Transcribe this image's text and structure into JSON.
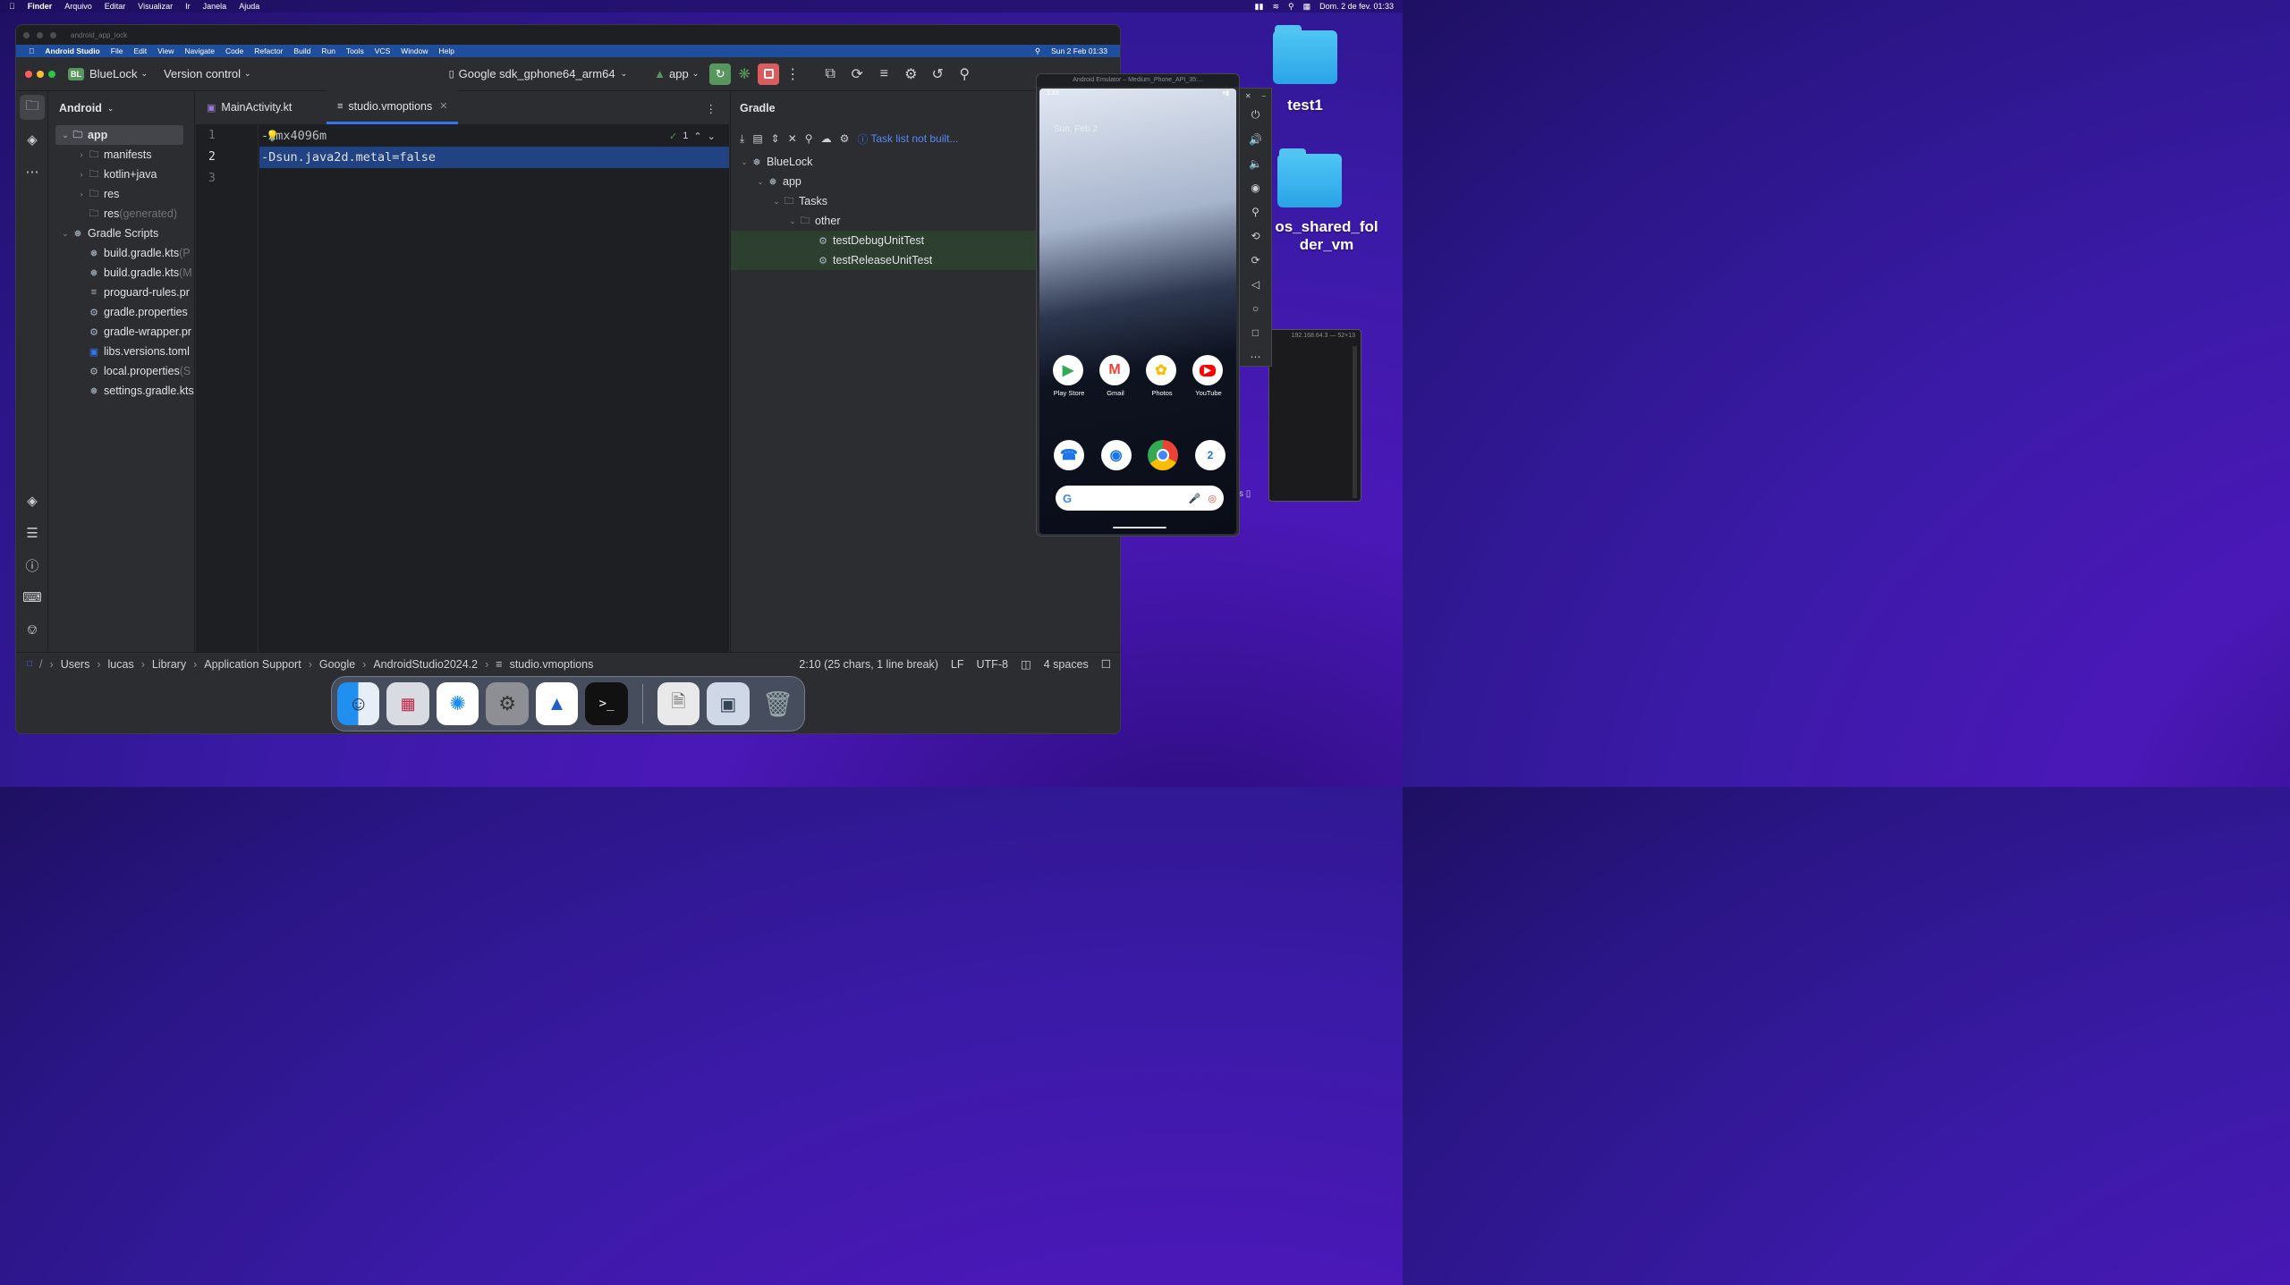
{
  "mac_menubar": {
    "apple": "",
    "items": [
      "Finder",
      "Arquivo",
      "Editar",
      "Visualizar",
      "Ir",
      "Janela",
      "Ajuda"
    ],
    "datetime": "Dom. 2 de fev.  01:33"
  },
  "desktop": {
    "folder1": "test1",
    "folder2_line1": "os_shared_fol",
    "folder2_line2": "der_vm"
  },
  "window": {
    "title": "android_app_lock",
    "as_menu": [
      "Android Studio",
      "File",
      "Edit",
      "View",
      "Navigate",
      "Code",
      "Refactor",
      "Build",
      "Run",
      "Tools",
      "VCS",
      "Window",
      "Help"
    ],
    "as_menu_time": "Sun 2 Feb  01:33",
    "project_badge": "BL",
    "project_name": "BlueLock",
    "vcs": "Version control",
    "device": "Google sdk_gphone64_arm64",
    "run_config": "app"
  },
  "project_panel": {
    "title": "Android",
    "items": [
      {
        "label": "app",
        "extra": ""
      },
      {
        "label": "manifests",
        "extra": ""
      },
      {
        "label": "kotlin+java",
        "extra": ""
      },
      {
        "label": "res",
        "extra": ""
      },
      {
        "label": "res",
        "extra": " (generated)"
      },
      {
        "label": "Gradle Scripts",
        "extra": ""
      },
      {
        "label": "build.gradle.kts",
        "extra": " (P"
      },
      {
        "label": "build.gradle.kts",
        "extra": " (M"
      },
      {
        "label": "proguard-rules.pr",
        "extra": ""
      },
      {
        "label": "gradle.properties",
        "extra": ""
      },
      {
        "label": "gradle-wrapper.pr",
        "extra": ""
      },
      {
        "label": "libs.versions.toml",
        "extra": ""
      },
      {
        "label": "local.properties",
        "extra": " (S"
      },
      {
        "label": "settings.gradle.kts",
        "extra": ""
      }
    ]
  },
  "editor": {
    "tabs": [
      "MainActivity.kt",
      "studio.vmoptions"
    ],
    "line_numbers": [
      "1",
      "2",
      "3"
    ],
    "lines": [
      "-Xmx4096m",
      "-Dsun.java2d.metal=false",
      ""
    ],
    "inspection_count": "1"
  },
  "gradle": {
    "title": "Gradle",
    "task_notice": "Task list not built...",
    "tree": [
      "BlueLock",
      "app",
      "Tasks",
      "other",
      "testDebugUnitTest",
      "testReleaseUnitTest"
    ]
  },
  "statusbar": {
    "breadcrumb": [
      "Users",
      "lucas",
      "Library",
      "Application Support",
      "Google",
      "AndroidStudio2024.2",
      "studio.vmoptions"
    ],
    "position": "2:10 (25 chars, 1 line break)",
    "line_sep": "LF",
    "encoding": "UTF-8",
    "indent": "4 spaces"
  },
  "emulator": {
    "title": "Android Emulator – Medium_Phone_API_35:...",
    "time": "1:33",
    "date": "Sun, Feb 2",
    "apps": [
      "Play Store",
      "Gmail",
      "Photos",
      "YouTube"
    ]
  },
  "terminal": {
    "title": "192.168.64.3 — 52×13"
  },
  "colors": {
    "accent": "#3574f0",
    "selection": "#214283",
    "run_green": "#57965c",
    "stop_red": "#db5c5c"
  }
}
